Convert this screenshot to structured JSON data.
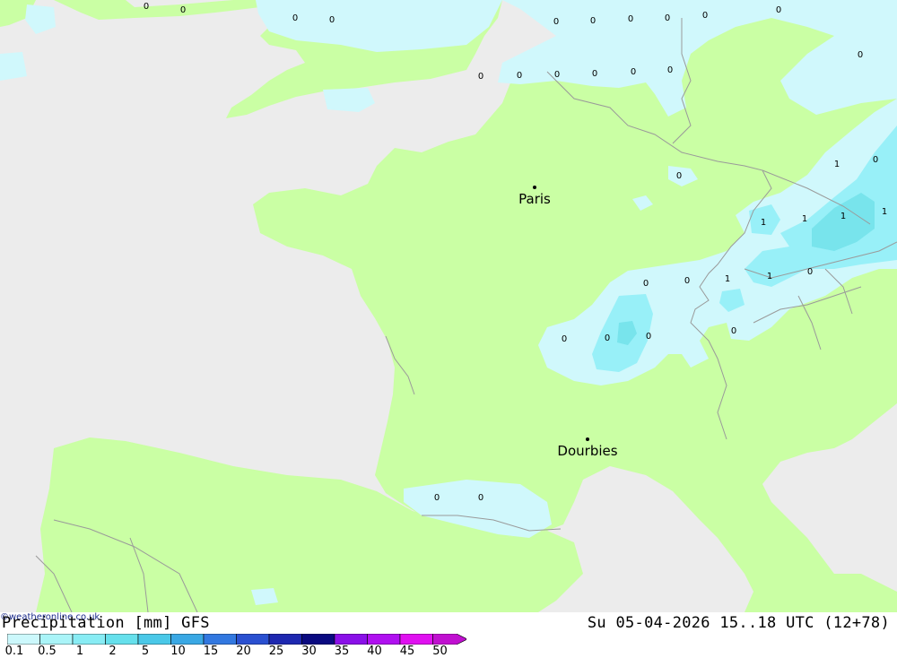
{
  "colors": {
    "sea": "#ececec",
    "land": "#caffa4",
    "precip_light": "#d0f8fc",
    "precip_med": "#98f0f8",
    "precip_strong": "#78e4ec",
    "border": "#9a9a9a"
  },
  "cities": [
    {
      "name": "Paris"
    },
    {
      "name": "Dourbies"
    }
  ],
  "value_labels": [
    "0",
    "0",
    "0",
    "0",
    "0",
    "0",
    "0",
    "0",
    "0",
    "0",
    "0",
    "0",
    "0",
    "0",
    "0",
    "0",
    "0",
    "0",
    "1",
    "0",
    "1",
    "1",
    "1",
    "1",
    "1",
    "0",
    "0",
    "0",
    "1",
    "0",
    "0",
    "0",
    "0",
    "0",
    "0"
  ],
  "footer": {
    "legend_title": "Precipitation [mm] GFS",
    "valid_time": "Su 05-04-2026 15..18 UTC (12+78)",
    "credit": "©weatheronline.co.uk"
  },
  "legend": {
    "levels": [
      "0.1",
      "0.5",
      "1",
      "2",
      "5",
      "10",
      "15",
      "20",
      "25",
      "30",
      "35",
      "40",
      "45",
      "50"
    ],
    "colors": [
      "#ccf8fc",
      "#aaf4f8",
      "#88ecf4",
      "#66e0ec",
      "#4ac8e8",
      "#3aa8e4",
      "#3278e0",
      "#2a50d0",
      "#1e28b0",
      "#0a0a80",
      "#8a10e8",
      "#b010f0",
      "#e010f0",
      "#c010d0"
    ]
  }
}
